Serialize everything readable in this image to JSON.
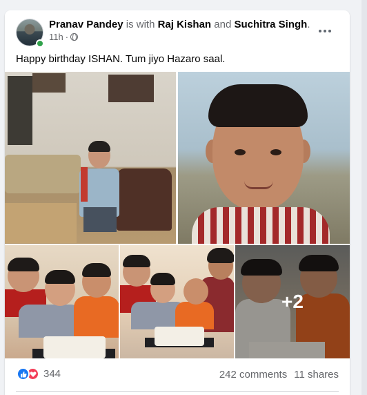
{
  "post": {
    "author": "Pranav Pandey",
    "with_text": " is with ",
    "tagged_1": "Raj Kishan",
    "and_text": " and ",
    "tagged_2": "Suchitra Singh",
    "trailing": ".",
    "time": "11h",
    "separator": "·",
    "privacy_icon": "globe-icon",
    "text": "Happy birthday ISHAN. Tum jiyo Hazaro saal."
  },
  "photos": {
    "more_count": "+2"
  },
  "footer": {
    "reaction_icons": [
      "like-icon",
      "love-icon"
    ],
    "reaction_count": "344",
    "comments": "242 comments",
    "shares": "11 shares"
  },
  "colors": {
    "link_blue": "#1877f2",
    "love_red": "#f33e58",
    "secondary_text": "#65676b",
    "online_green": "#31a24c"
  }
}
